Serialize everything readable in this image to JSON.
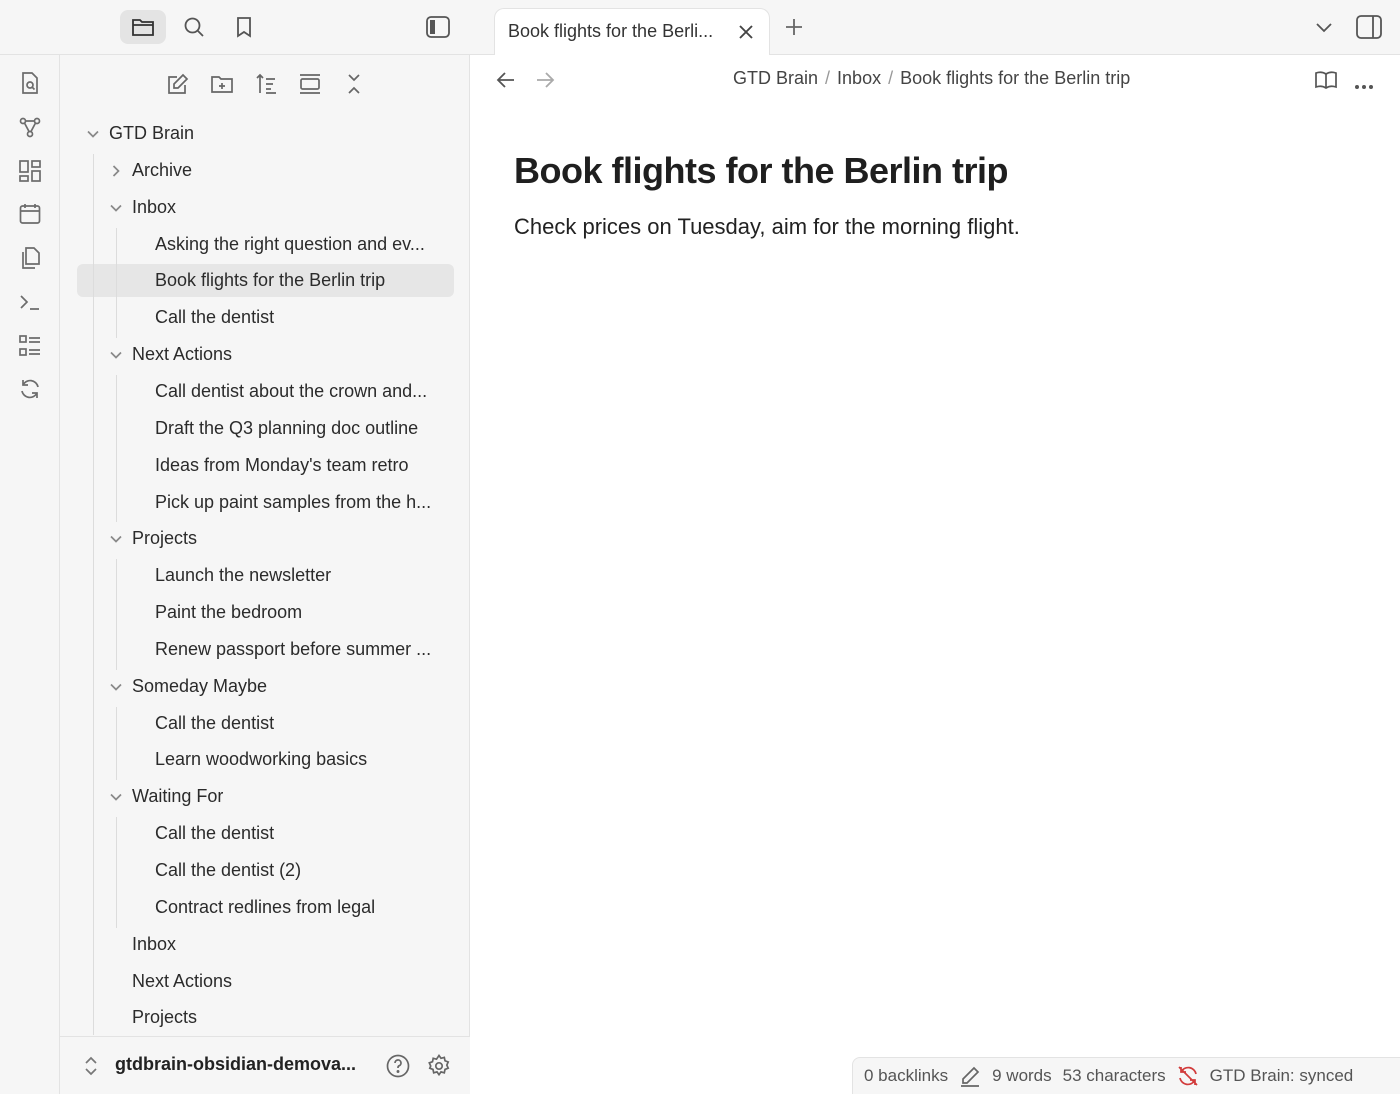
{
  "left_header": {
    "buttons": [
      {
        "name": "files-icon"
      },
      {
        "name": "search-icon"
      },
      {
        "name": "bookmark-icon"
      }
    ]
  },
  "ribbon": [
    {
      "name": "quick-switcher-icon"
    },
    {
      "name": "graph-view-icon"
    },
    {
      "name": "canvas-icon"
    },
    {
      "name": "daily-note-icon"
    },
    {
      "name": "templates-icon"
    },
    {
      "name": "command-palette-icon"
    },
    {
      "name": "outline-icon"
    },
    {
      "name": "sync-icon"
    }
  ],
  "sidebar": {
    "toolbar": [
      {
        "name": "new-note-icon"
      },
      {
        "name": "new-folder-icon"
      },
      {
        "name": "sort-icon"
      },
      {
        "name": "auto-reveal-icon"
      },
      {
        "name": "collapse-all-icon"
      }
    ],
    "tree": [
      {
        "label": "GTD Brain",
        "level": 0,
        "chevron": "down"
      },
      {
        "label": "Archive",
        "level": 1,
        "chevron": "right"
      },
      {
        "label": "Inbox",
        "level": 1,
        "chevron": "down"
      },
      {
        "label": "Asking the right question and ev...",
        "level": 2
      },
      {
        "label": "Book flights for the Berlin trip",
        "level": 2,
        "selected": true
      },
      {
        "label": "Call the dentist",
        "level": 2
      },
      {
        "label": "Next Actions",
        "level": 1,
        "chevron": "down"
      },
      {
        "label": "Call dentist about the crown and...",
        "level": 2
      },
      {
        "label": "Draft the Q3 planning doc outline",
        "level": 2
      },
      {
        "label": "Ideas from Monday's team retro",
        "level": 2
      },
      {
        "label": "Pick up paint samples from the h...",
        "level": 2
      },
      {
        "label": "Projects",
        "level": 1,
        "chevron": "down"
      },
      {
        "label": "Launch the newsletter",
        "level": 2
      },
      {
        "label": "Paint the bedroom",
        "level": 2
      },
      {
        "label": "Renew passport before summer ...",
        "level": 2
      },
      {
        "label": "Someday Maybe",
        "level": 1,
        "chevron": "down"
      },
      {
        "label": "Call the dentist",
        "level": 2
      },
      {
        "label": "Learn woodworking basics",
        "level": 2
      },
      {
        "label": "Waiting For",
        "level": 1,
        "chevron": "down"
      },
      {
        "label": "Call the dentist",
        "level": 2
      },
      {
        "label": "Call the dentist (2)",
        "level": 2
      },
      {
        "label": "Contract redlines from legal",
        "level": 2
      },
      {
        "label": "Inbox",
        "level": 1
      },
      {
        "label": "Next Actions",
        "level": 1
      },
      {
        "label": "Projects",
        "level": 1
      }
    ],
    "vault_name": "gtdbrain-obsidian-demova..."
  },
  "tab": {
    "title": "Book flights for the Berli..."
  },
  "breadcrumb": {
    "vault": "GTD Brain",
    "folder": "Inbox",
    "note": "Book flights for the Berlin trip",
    "separator": "/"
  },
  "note": {
    "title": "Book flights for the Berlin trip",
    "body": "Check prices on Tuesday, aim for the morning flight."
  },
  "status": {
    "backlinks": "0 backlinks",
    "words": "9 words",
    "characters": "53 characters",
    "sync": "GTD Brain: synced",
    "sync_icon_color": "#d23c3c"
  }
}
